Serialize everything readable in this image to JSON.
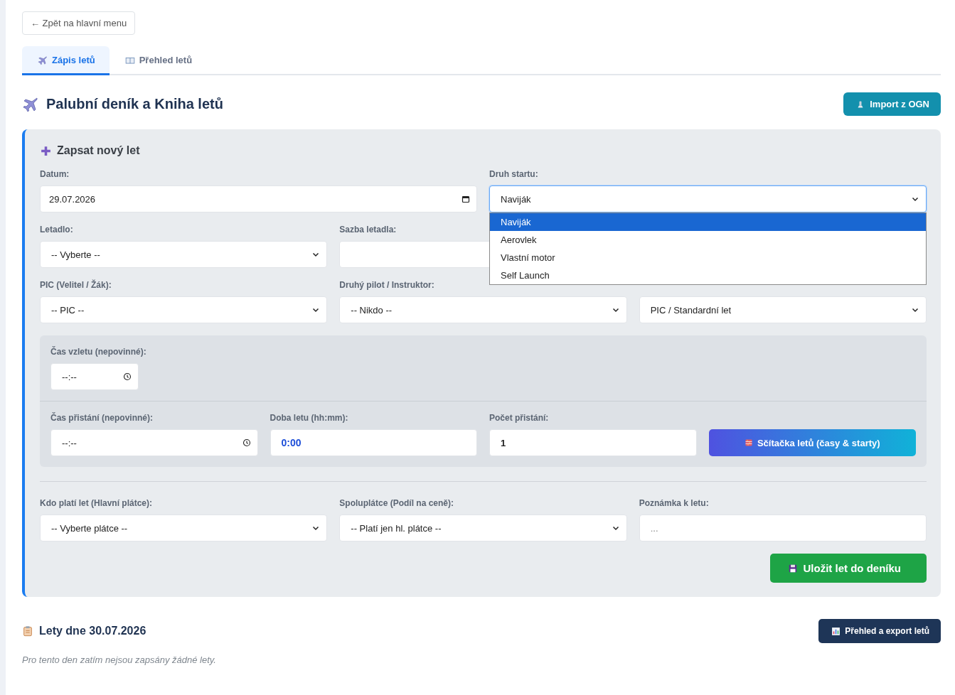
{
  "back_button": "← Zpět na hlavní menu",
  "tabs": [
    {
      "label": "Zápis letů",
      "selected": true
    },
    {
      "label": "Přehled letů",
      "selected": false
    }
  ],
  "header": {
    "title": "Palubní deník a Kniha letů",
    "import_button": "Import z OGN"
  },
  "form": {
    "title": "Zapsat nový let",
    "rows": [
      {
        "fields": [
          {
            "label": "Datum:",
            "kind": "date",
            "value": "29.07.2026"
          },
          {
            "label": "Druh startu:",
            "kind": "select",
            "value": "Naviják",
            "open": true,
            "options": [
              {
                "label": "Naviják",
                "selected": true
              },
              {
                "label": "Aerovlek",
                "selected": false
              },
              {
                "label": "Vlastní motor",
                "selected": false
              },
              {
                "label": "Self Launch",
                "selected": false
              }
            ]
          }
        ]
      },
      {
        "fields": [
          {
            "label": "Letadlo:",
            "kind": "select",
            "value": "-- Vyberte --"
          },
          {
            "label": "Sazba letadla:",
            "kind": "text"
          }
        ]
      },
      {
        "fields": [
          {
            "label": "PIC (Velitel / Žák):",
            "kind": "select",
            "value": "-- PIC --"
          },
          {
            "label": "Druhý pilot / Instruktor:",
            "kind": "select",
            "value": "-- Nikdo --"
          },
          {
            "kind": "select",
            "value": "PIC / Standardní let"
          }
        ]
      }
    ],
    "takeoff": {
      "label": "Čas vzletu (nepovinné):",
      "kind": "time",
      "value": "--:--"
    },
    "times": [
      {
        "label": "Čas přistání (nepovinné):",
        "kind": "time",
        "value": "--:--"
      },
      {
        "label": "Doba letu (hh:mm):",
        "kind": "duration",
        "value": "0:00"
      },
      {
        "label": "Počet přistání:",
        "kind": "number",
        "value": "1"
      }
    ],
    "calculator_button": "Sčítačka letů (časy & starty)",
    "payment": [
      {
        "label": "Kdo platí let (Hlavní plátce):",
        "kind": "select",
        "value": "-- Vyberte plátce --"
      },
      {
        "label": "Spoluplátce (Podíl na ceně):",
        "kind": "select",
        "value": "-- Platí jen hl. plátce --"
      },
      {
        "label": "Poznámka k letu:",
        "kind": "text",
        "placeholder": "..."
      }
    ],
    "save_button": "Uložit let do deníku"
  },
  "flights": {
    "title": "Lety dne 30.07.2026",
    "export_button": "Přehled a export letů",
    "empty_text": "Pro tento den zatím nejsou zapsány žádné lety."
  }
}
